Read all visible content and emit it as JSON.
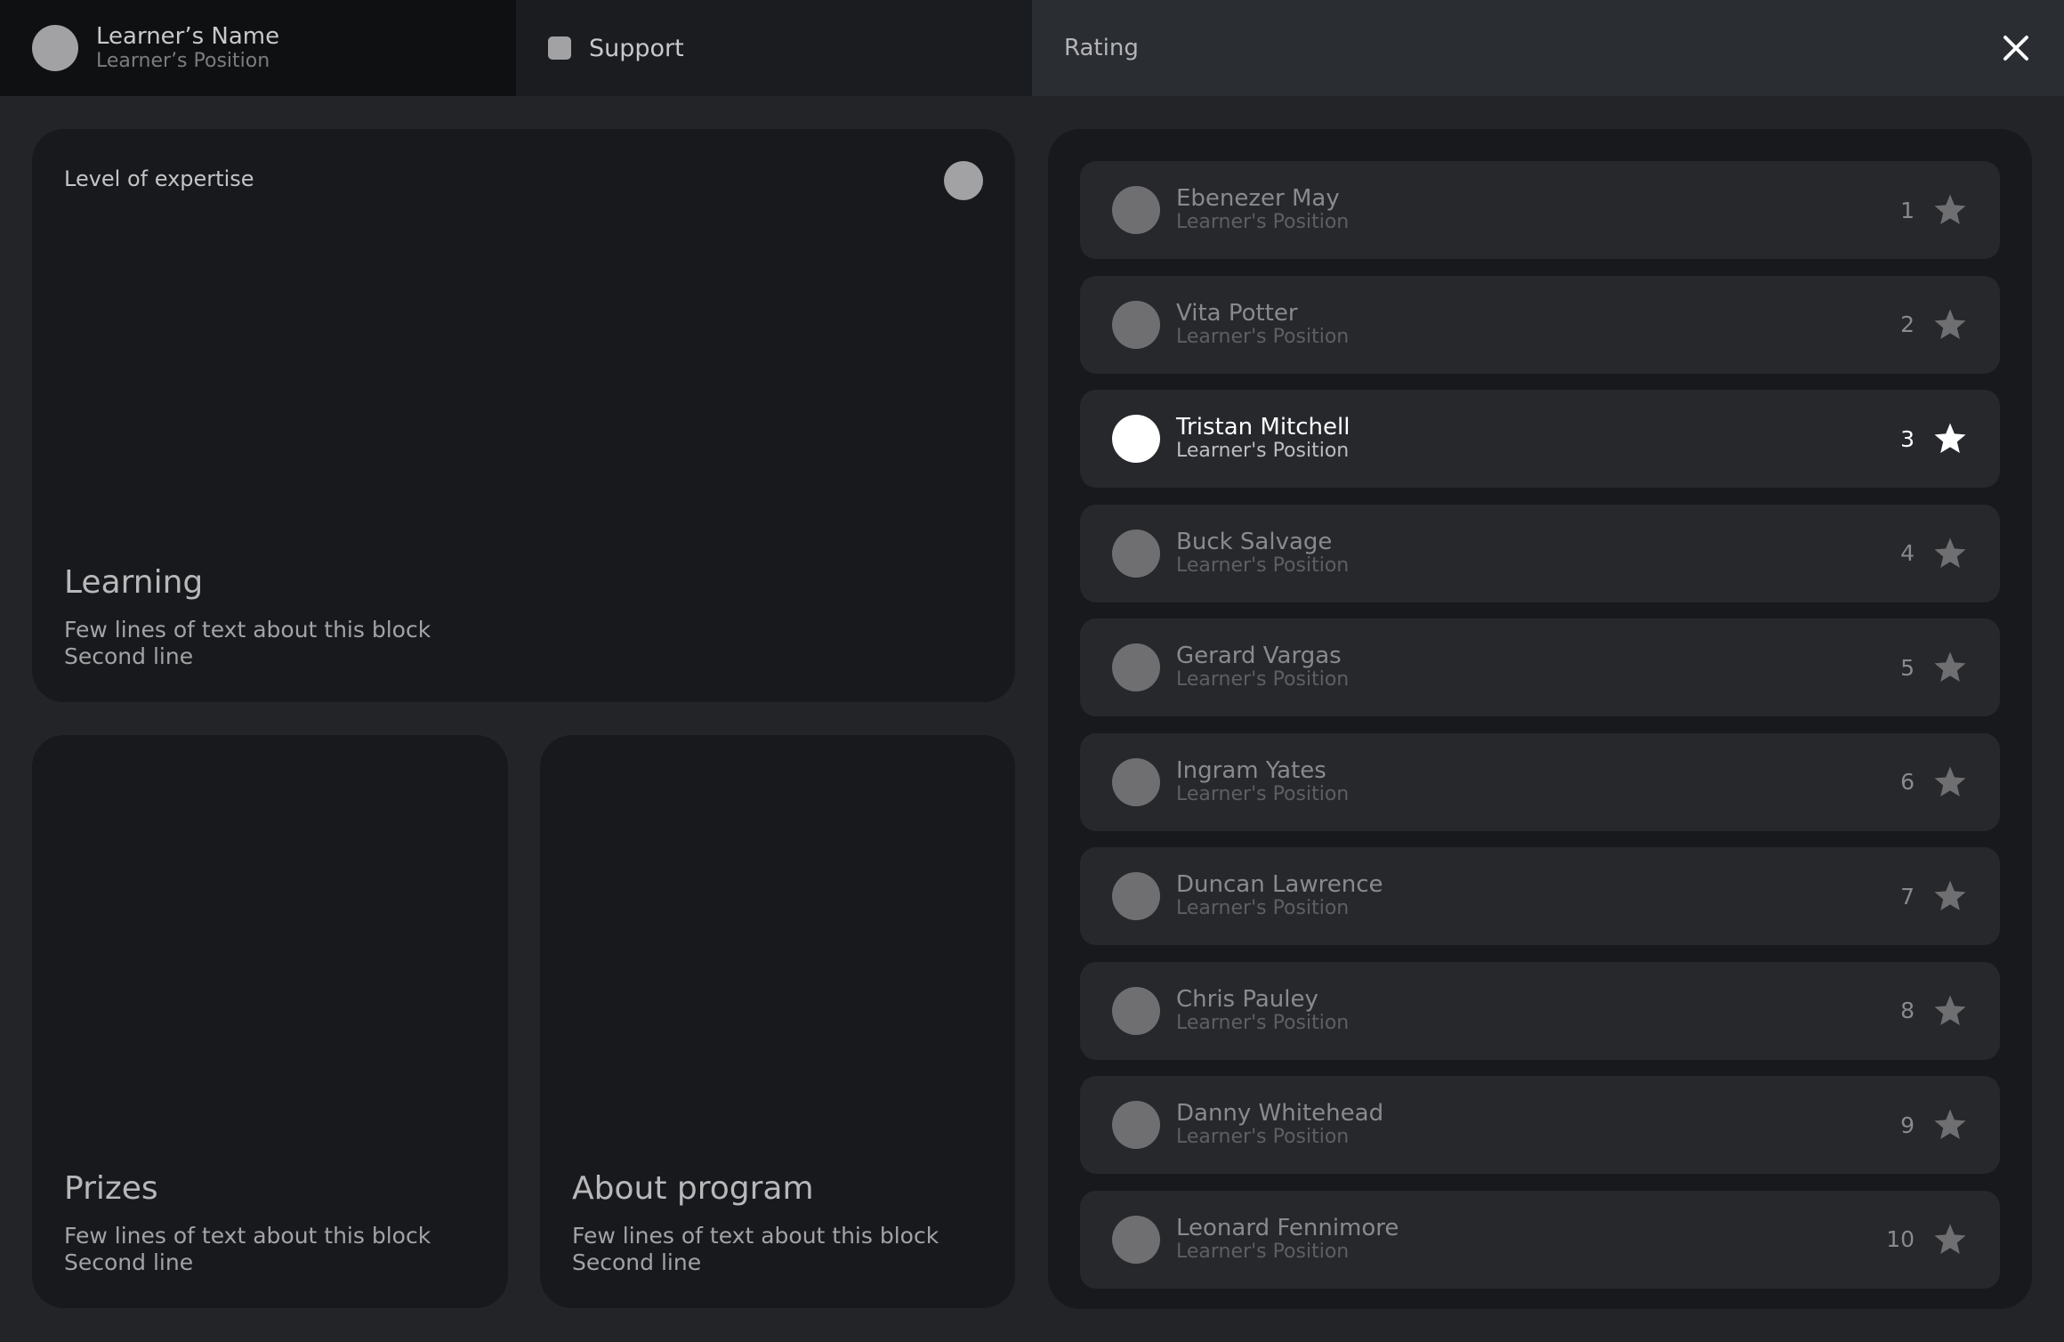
{
  "header": {
    "profile": {
      "name": "Learner’s Name",
      "position": "Learner’s  Position"
    },
    "support_label": "Support",
    "rating_label": "Rating",
    "close_icon": "close-icon"
  },
  "cards": {
    "expertise": {
      "label": "Level of expertise",
      "title": "Learning",
      "line1": "Few lines of text about this block",
      "line2": "Second line"
    },
    "prizes": {
      "title": "Prizes",
      "line1": "Few lines of text about this block",
      "line2": "Second line"
    },
    "about": {
      "title": "About program",
      "line1": "Few lines of text about this block",
      "line2": "Second line"
    }
  },
  "rating": {
    "items": [
      {
        "name": "Ebenezer May",
        "position": "Learner's  Position",
        "rank": "1"
      },
      {
        "name": "Vita Potter",
        "position": "Learner's  Position",
        "rank": "2"
      },
      {
        "name": "Tristan Mitchell",
        "position": "Learner's  Position",
        "rank": "3",
        "active": true
      },
      {
        "name": "Buck Salvage",
        "position": "Learner's  Position",
        "rank": "4"
      },
      {
        "name": "Gerard Vargas",
        "position": "Learner's  Position",
        "rank": "5"
      },
      {
        "name": "Ingram Yates",
        "position": "Learner's  Position",
        "rank": "6"
      },
      {
        "name": "Duncan Lawrence",
        "position": "Learner's  Position",
        "rank": "7"
      },
      {
        "name": "Chris Pauley",
        "position": "Learner's  Position",
        "rank": "8"
      },
      {
        "name": "Danny Whitehead",
        "position": "Learner's  Position",
        "rank": "9"
      },
      {
        "name": "Leonard Fennimore",
        "position": "Learner's  Position",
        "rank": "10"
      }
    ]
  },
  "colors": {
    "background": "#222428",
    "card": "#18191c",
    "row": "#26282c",
    "active": "#ffffff"
  }
}
